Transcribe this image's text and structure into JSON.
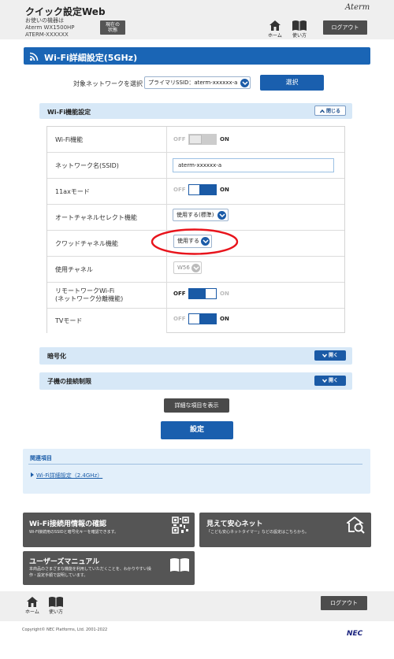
{
  "header": {
    "title": "クイック設定Web",
    "line1": "お使いの機器は",
    "model": "Aterm WX1500HP",
    "ssid": "ATERM-XXXXXX",
    "status_button": [
      "現在の",
      "状態"
    ],
    "brand": "Aterm",
    "home_label": "ホーム",
    "howto_label": "使い方",
    "logout_label": "ログアウト"
  },
  "page": {
    "title": "Wi-Fi詳細設定(5GHz)"
  },
  "network_select": {
    "label": "対象ネットワークを選択",
    "value": "プライマリSSID：aterm-xxxxxx-a",
    "select_button": "選択"
  },
  "wifi_section": {
    "title": "Wi-Fi機能設定",
    "close_label": "閉じる",
    "rows": {
      "wifi": {
        "label": "Wi-Fi機能",
        "off": "OFF",
        "on": "ON",
        "state": "disabled"
      },
      "ssid": {
        "label": "ネットワーク名(SSID)",
        "value": "aterm-xxxxxx-a"
      },
      "ax": {
        "label": "11axモード",
        "off": "OFF",
        "on": "ON",
        "state": "on"
      },
      "auto_channel": {
        "label": "オートチャネルセレクト機能",
        "value": "使用する(標準)"
      },
      "crowd_channel": {
        "label": "クワッドチャネル機能",
        "value": "使用する"
      },
      "channel": {
        "label": "使用チャネル",
        "value": "W56"
      },
      "remote": {
        "label1": "リモートワークWi-Fi",
        "label2": "(ネットワーク分離機能)",
        "off": "OFF",
        "on": "ON",
        "state": "off"
      },
      "tv": {
        "label": "TVモード",
        "off": "OFF",
        "on": "ON",
        "state": "on"
      }
    }
  },
  "sections": {
    "encryption": {
      "title": "暗号化",
      "open_label": "開く"
    },
    "child": {
      "title": "子機の接続制限",
      "open_label": "開く"
    }
  },
  "buttons": {
    "detail": "詳細な項目を表示",
    "set": "設定"
  },
  "related": {
    "title": "関連項目",
    "link": "Wi-Fi詳細設定（2.4GHz）"
  },
  "tiles": {
    "wifi_info": {
      "title": "Wi-Fi接続用情報の確認",
      "desc": "Wi-Fi接続用のSSIDと暗号化キーを確認できます。"
    },
    "anshin": {
      "title": "見えて安心ネット",
      "desc": "「こども安心ネットタイマー」などの設定はこちらから。"
    },
    "manual": {
      "title": "ユーザーズマニュアル",
      "desc1": "本商品のさまざまな機能を利用していただくことを、わかりやすい操",
      "desc2": "作・設定手順で説明しています。"
    }
  },
  "footer": {
    "home_label": "ホーム",
    "howto_label": "使い方",
    "logout_label": "ログアウト",
    "copyright": "Copyright© NEC Platforms, Ltd. 2001-2022",
    "logo": "NEC"
  },
  "colors": {
    "primary": "#1a65b5",
    "panel": "#d7e8f7",
    "highlight": "#e8141c"
  }
}
